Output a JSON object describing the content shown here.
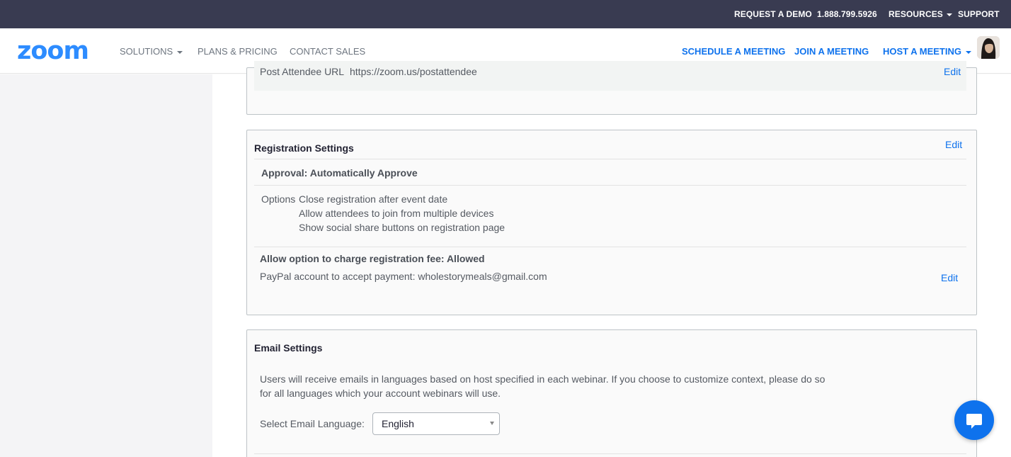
{
  "topbar": {
    "request_demo": "REQUEST A DEMO",
    "phone": "1.888.799.5926",
    "resources": "RESOURCES",
    "support": "SUPPORT"
  },
  "nav": {
    "logo": "zoom",
    "solutions": "SOLUTIONS",
    "plans": "PLANS & PRICING",
    "contact": "CONTACT SALES",
    "schedule": "SCHEDULE A MEETING",
    "join": "JOIN A MEETING",
    "host": "HOST A MEETING"
  },
  "post_attendee": {
    "label": "Post Attendee URL",
    "url": "https://zoom.us/postattendee",
    "edit": "Edit"
  },
  "registration": {
    "title": "Registration Settings",
    "edit": "Edit",
    "approval": "Approval: Automatically Approve",
    "options_label": "Options",
    "options": [
      "Close registration after event date",
      "Allow attendees to join from multiple devices",
      "Show social share buttons on registration page"
    ],
    "fee": "Allow option to charge registration fee: Allowed",
    "paypal": "PayPal account to accept payment: wholestorymeals@gmail.com",
    "paypal_edit": "Edit"
  },
  "email": {
    "title": "Email Settings",
    "description_line1": "Users will receive emails in languages based on host specified in each webinar. If you choose to customize context, please do so",
    "description_line2": "for all languages which your account webinars will use.",
    "language_label": "Select Email Language:",
    "language_value": "English"
  },
  "colors": {
    "topbar": "#393b51",
    "accent": "#0e72ed",
    "logo": "#2d8cff"
  }
}
